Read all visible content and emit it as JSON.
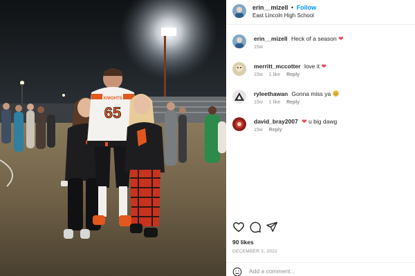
{
  "post": {
    "author": {
      "username": "erin__mizell",
      "separator": "•",
      "follow_label": "Follow",
      "location": "East Lincoln High School"
    },
    "comments": [
      {
        "username": "erin__mizell",
        "text": "Heck of a season",
        "emoji": "heart",
        "emoji_glyph": "❤",
        "age": "15w",
        "likes": "",
        "reply_label": ""
      },
      {
        "username": "merritt_mccotter",
        "text": "love it",
        "emoji": "heart",
        "emoji_glyph": "❤",
        "age": "15w",
        "likes": "1 like",
        "reply_label": "Reply"
      },
      {
        "username": "ryleethawan",
        "text": "Gonna miss ya",
        "emoji": "smiling-face",
        "emoji_glyph": "😊",
        "age": "15w",
        "likes": "1 like",
        "reply_label": "Reply"
      },
      {
        "username": "david_bray2007",
        "text": "u big dawg",
        "emoji": "heart",
        "emoji_glyph": "❤",
        "age": "15w",
        "likes": "",
        "reply_label": "Reply"
      }
    ],
    "likes_count": "90 likes",
    "date": "December 2, 2022",
    "add_comment_placeholder": "Add a comment...",
    "icons": {
      "like": "heart-outline-icon",
      "comment": "speech-bubble-icon",
      "share": "paper-plane-icon",
      "emoji": "smiley-icon"
    }
  },
  "photo": {
    "jersey_number": "65",
    "jersey_team_text": "KNIGHTS",
    "colors": {
      "jersey_number": "#e2571e",
      "heart": "#ed4956",
      "follow": "#0095f6"
    }
  }
}
